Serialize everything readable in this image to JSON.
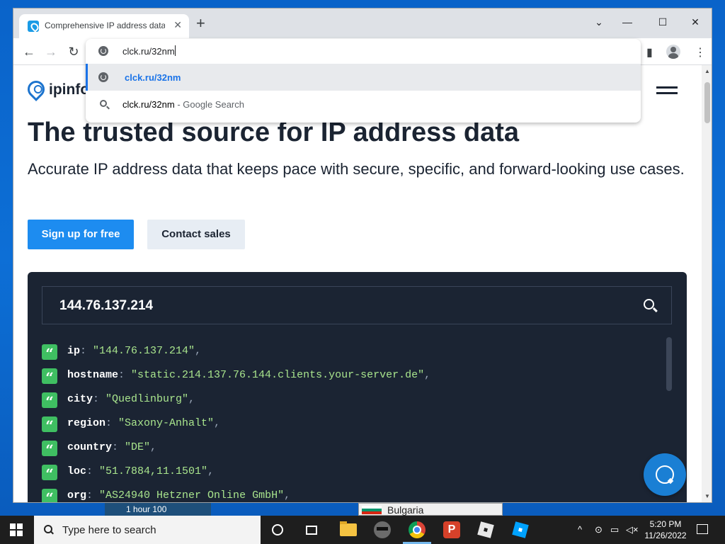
{
  "browser": {
    "tab_title": "Comprehensive IP address data, I",
    "tab_close": "✕",
    "new_tab": "+",
    "window_controls": {
      "chevron": "⌄",
      "minimize": "—",
      "maximize": "☐",
      "close": "✕"
    },
    "nav": {
      "back": "←",
      "forward": "→",
      "reload": "↻"
    },
    "omnibox": {
      "input_value": "clck.ru/32nm",
      "suggestions": [
        {
          "text": "clck.ru/32nm",
          "hint": "",
          "icon": "globe-icon",
          "selected": true
        },
        {
          "text": "clck.ru/32nm",
          "hint": " - Google Search",
          "icon": "search-icon",
          "selected": false
        }
      ]
    },
    "toolbar_right": {
      "sidebar": "▮",
      "menu": "⋮"
    }
  },
  "page": {
    "logo_text": "ipinfo.",
    "hero": {
      "title": "The trusted source for IP address data",
      "subtitle": "Accurate IP address data that keeps pace with secure, specific, and forward-looking use cases."
    },
    "buttons": {
      "signup": "Sign up for free",
      "contact": "Contact sales"
    },
    "lookup": {
      "ip_value": "144.76.137.214",
      "fields": [
        {
          "key": "ip",
          "value": "\"144.76.137.214\""
        },
        {
          "key": "hostname",
          "value": "\"static.214.137.76.144.clients.your-server.de\""
        },
        {
          "key": "city",
          "value": "\"Quedlinburg\""
        },
        {
          "key": "region",
          "value": "\"Saxony-Anhalt\""
        },
        {
          "key": "country",
          "value": "\"DE\""
        },
        {
          "key": "loc",
          "value": "\"51.7884,11.1501\""
        },
        {
          "key": "org",
          "value": "\"AS24940 Hetzner Online GmbH\""
        }
      ],
      "quote_glyph": "“"
    }
  },
  "background_apps": {
    "app_a": "1 hour 100",
    "app_b": "Bulgaria"
  },
  "taskbar": {
    "search_placeholder": "Type here to search",
    "apps": [
      "cortana-icon",
      "task-view-icon",
      "file-explorer-icon",
      "raccoon-app-icon",
      "chrome-icon",
      "psiphon-icon",
      "roblox-icon",
      "roblox-studio-icon"
    ],
    "psiphon_letter": "P",
    "tray": {
      "chevron": "^"
    },
    "time": "5:20 PM",
    "date": "11/26/2022"
  },
  "colors": {
    "accent_blue": "#1d8cf0",
    "console_bg": "#1b2433",
    "json_value_green": "#a9e58d",
    "quote_badge_green": "#3fbf62"
  }
}
